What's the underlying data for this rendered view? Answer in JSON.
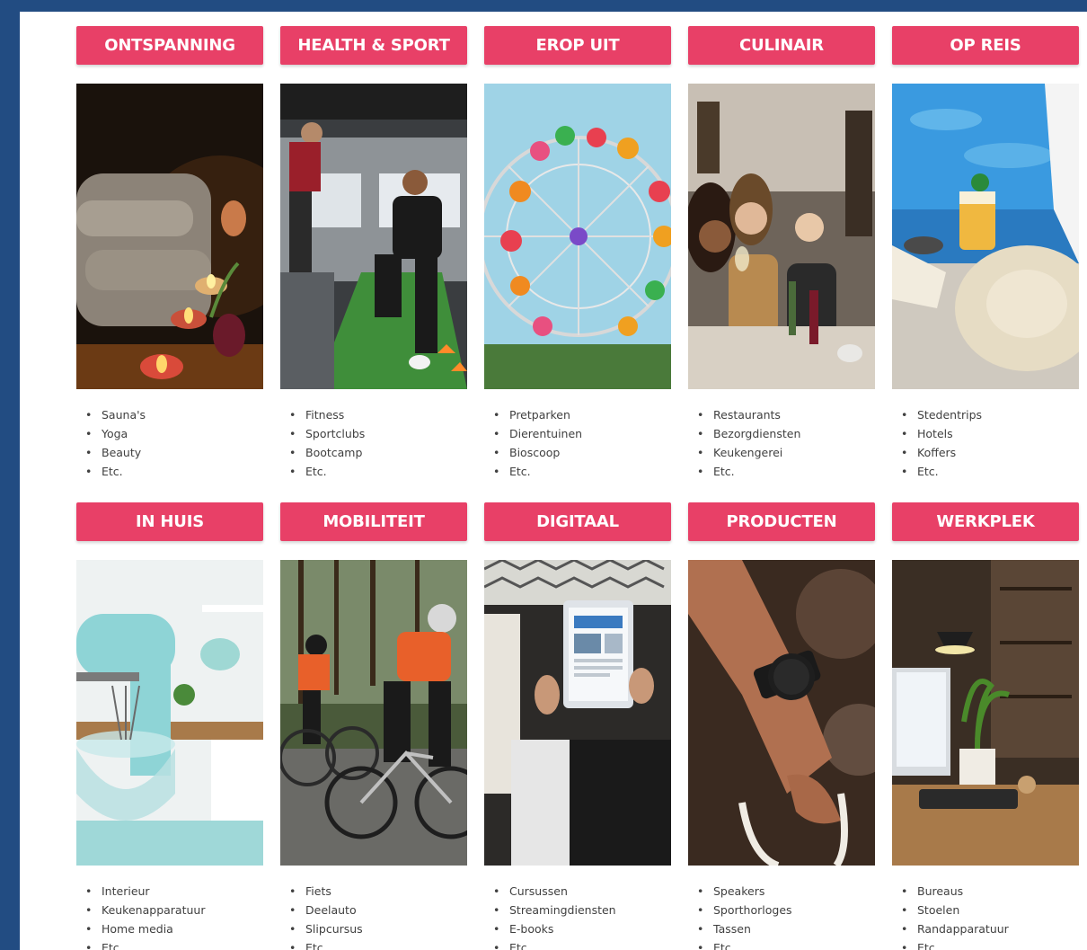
{
  "categories": [
    {
      "id": "ontspanning",
      "title": "ONTSPANNING",
      "items": [
        "Sauna's",
        "Yoga",
        "Beauty",
        "Etc."
      ]
    },
    {
      "id": "health-sport",
      "title": "HEALTH & SPORT",
      "items": [
        "Fitness",
        "Sportclubs",
        "Bootcamp",
        "Etc."
      ]
    },
    {
      "id": "erop-uit",
      "title": "EROP UIT",
      "items": [
        "Pretparken",
        "Dierentuinen",
        "Bioscoop",
        "Etc."
      ]
    },
    {
      "id": "culinair",
      "title": "CULINAIR",
      "items": [
        "Restaurants",
        "Bezorgdiensten",
        "Keukengerei",
        "Etc."
      ]
    },
    {
      "id": "op-reis",
      "title": "OP REIS",
      "items": [
        "Stedentrips",
        "Hotels",
        "Koffers",
        "Etc."
      ]
    },
    {
      "id": "in-huis",
      "title": "IN HUIS",
      "items": [
        "Interieur",
        "Keukenapparatuur",
        "Home media",
        "Etc."
      ]
    },
    {
      "id": "mobiliteit",
      "title": "MOBILITEIT",
      "items": [
        "Fiets",
        "Deelauto",
        "Slipcursus",
        "Etc."
      ]
    },
    {
      "id": "digitaal",
      "title": "DIGITAAL",
      "items": [
        "Cursussen",
        "Streamingdiensten",
        "E-books",
        "Etc."
      ]
    },
    {
      "id": "producten",
      "title": "PRODUCTEN",
      "items": [
        "Speakers",
        "Sporthorloges",
        "Tassen",
        "Etc."
      ]
    },
    {
      "id": "werkplek",
      "title": "WERKPLEK",
      "items": [
        "Bureaus",
        "Stoelen",
        "Randapparatuur",
        "Etc."
      ]
    }
  ],
  "colors": {
    "page_background": "#224c82",
    "panel_background": "#ffffff",
    "button_background": "#e84067",
    "button_text": "#ffffff",
    "list_text": "#404040"
  }
}
